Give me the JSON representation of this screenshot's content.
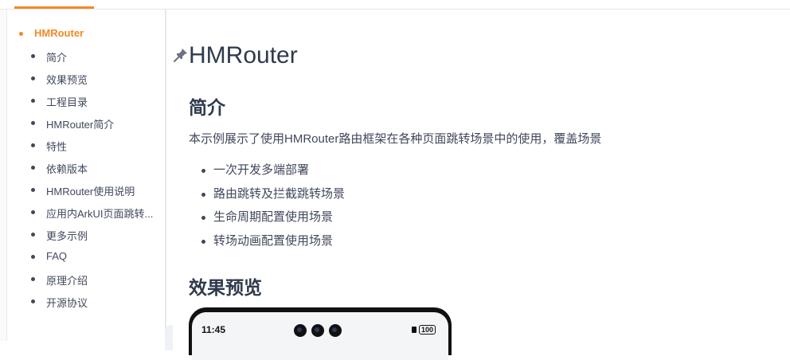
{
  "toc": {
    "items": [
      {
        "label": "HMRouter",
        "active": true
      },
      {
        "label": "简介"
      },
      {
        "label": "效果预览"
      },
      {
        "label": "工程目录"
      },
      {
        "label": "HMRouter简介"
      },
      {
        "label": "特性"
      },
      {
        "label": "依赖版本"
      },
      {
        "label": "HMRouter使用说明"
      },
      {
        "label": "应用内ArkUI页面跳转..."
      },
      {
        "label": "更多示例"
      },
      {
        "label": "FAQ"
      },
      {
        "label": "原理介绍"
      },
      {
        "label": "开源协议"
      }
    ]
  },
  "article": {
    "title": "HMRouter",
    "sections": [
      {
        "heading": "简介"
      },
      {
        "heading": "效果预览"
      }
    ],
    "intro": "本示例展示了使用HMRouter路由框架在各种页面跳转场景中的使用，覆盖场景",
    "features": [
      "一次开发多端部署",
      "路由跳转及拦截跳转场景",
      "生命周期配置使用场景",
      "转场动画配置使用场景"
    ]
  },
  "preview": {
    "time": "11:45",
    "battery": "100"
  },
  "colors": {
    "accent": "#f08a24",
    "text": "#40485b",
    "heading": "#2f3a4c"
  }
}
